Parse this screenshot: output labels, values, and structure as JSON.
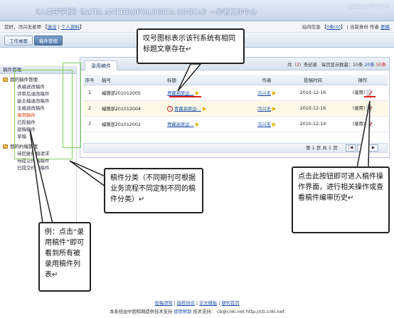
{
  "header": {
    "title": "《人类学学报》《ACTA ANTHROPOLOGICA SINICA》---作者工作中心",
    "datetime": "2013-01-07 17:47"
  },
  "user_bar": {
    "greeting": "您好，冯兴无老师",
    "logout": "退出",
    "profile": "个人资料",
    "messages_label": "站内信息",
    "messages_count": "0条(0)",
    "identity_label": "当前身份",
    "identity_value": "作者",
    "switch": "更换"
  },
  "nav": {
    "items": [
      {
        "label": "工作桌面",
        "active": false
      },
      {
        "label": "稿件管理",
        "active": true
      }
    ]
  },
  "sidebar": {
    "header": "稿件管理",
    "groups": [
      {
        "label": "我的稿件管理",
        "items": [
          {
            "label": "表编退改稿件",
            "active": false
          },
          {
            "label": "评审后退改稿件",
            "active": false
          },
          {
            "label": "副主编退改稿件",
            "active": false
          },
          {
            "label": "主编退改稿件",
            "active": false
          },
          {
            "label": "录用稿件",
            "active": true
          },
          {
            "label": "已投稿件",
            "active": false
          },
          {
            "label": "退稿稿件",
            "active": false
          },
          {
            "label": "草稿",
            "active": false
          }
        ]
      },
      {
        "label": "我的约稿管理",
        "items": [
          {
            "label": "待回复约稿请求",
            "active": false
          },
          {
            "label": "待提交约稿稿件",
            "active": false
          },
          {
            "label": "已提交约稿稿件",
            "active": false
          }
        ]
      }
    ]
  },
  "main": {
    "tab": "录用稿件",
    "summary_prefix": "共（",
    "summary_count": "3",
    "summary_suffix": "）条纪录",
    "per_page_prefix": "每页显示数量：",
    "per_page_options": [
      "10条",
      "20条",
      "50条"
    ],
    "columns": [
      "序号",
      "稿号",
      "标题",
      "作者",
      "投稿时间",
      "操作"
    ],
    "rows": [
      {
        "no": "1",
        "id": "编辑部201012005",
        "title": "青藏高原边…",
        "author": "冯兴无",
        "time": "2010-12-16",
        "status": "(录用)",
        "duplicate": false
      },
      {
        "no": "2",
        "id": "编辑部201012004",
        "title": "青藏高原边…",
        "author": "冯兴无",
        "time": "2010-12-16",
        "status": "(录用)",
        "duplicate": true
      },
      {
        "no": "3",
        "id": "编辑部201012002",
        "title": "青藏高原边…",
        "author": "冯兴无",
        "time": "2010-12-14",
        "status": "(录用)",
        "duplicate": false
      }
    ],
    "pager_text": "第 1 页 共 1 页"
  },
  "footer": {
    "links": [
      "投稿须知",
      "版权协议",
      "论文模板",
      "期刊首页"
    ],
    "copyright": "本系统由中国知网提供技术支持",
    "help": "使用帮助",
    "support_label": "技术支持：",
    "support_email": "cb@cnki.net",
    "support_url": "http://cb.cnki.net"
  },
  "annotations": {
    "callout_duplicate": "叹号图标表示该刊系统有相同标题文章存在↵",
    "callout_category": "稿件分类（不同期刊可根据业务流程不同定制不同的稿件分类）↵",
    "callout_operate": "点击此按钮即可进入稿件操作界面，进行相关操作或查看稿件编审历史↵",
    "callout_example": "例：点击“录用稿件”即可看到所有被录用稿件列表↵"
  }
}
